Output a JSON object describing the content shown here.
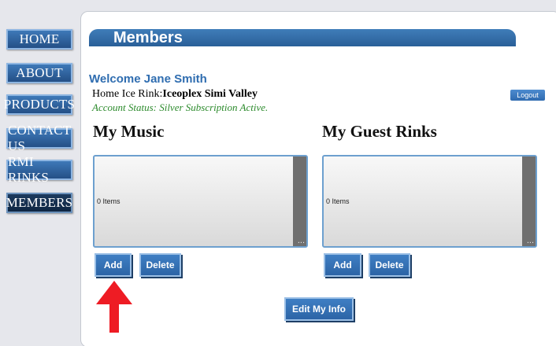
{
  "nav": {
    "home": "HOME",
    "about": "ABOUT",
    "products": "PRODUCTS",
    "contact": "CONTACT US",
    "rmi_rinks": "RMI RINKS",
    "members": "MEMBERS"
  },
  "header": {
    "title": "Members"
  },
  "user": {
    "welcome": "Welcome Jane Smith",
    "rink_label": "Home Ice Rink:",
    "rink_name": "Iceoplex Simi Valley",
    "status": "Account Status: Silver Subscription Active.",
    "logout_label": "Logout"
  },
  "music": {
    "title": "My Music",
    "count": "0 Items",
    "ellipsis": "...",
    "add_label": "Add",
    "delete_label": "Delete"
  },
  "guest_rinks": {
    "title": "My Guest Rinks",
    "count": "0 Items",
    "ellipsis": "...",
    "add_label": "Add",
    "delete_label": "Delete"
  },
  "edit_info_label": "Edit My Info",
  "colors": {
    "accent": "#2f6db0",
    "nav": "#2b5f9a",
    "status": "#2b8a2b",
    "arrow": "#ee1c24"
  },
  "annotation": {
    "arrow_icon": "red-up-arrow-icon"
  }
}
